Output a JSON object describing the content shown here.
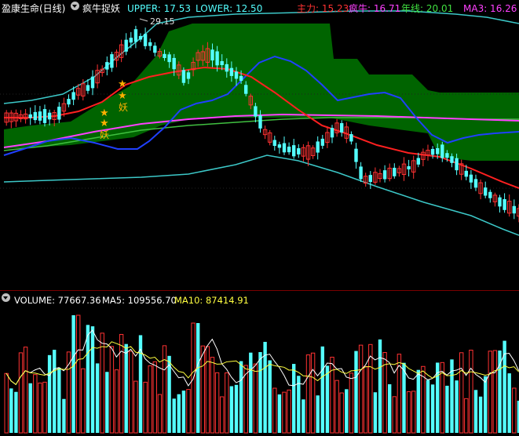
{
  "header": {
    "stock_name": "盈康生命(日线)",
    "indicator_name": "疯牛捉妖",
    "upper": "UPPER: 17.53",
    "lower": "LOWER: 12.50",
    "zhuli": "主力: 15.23",
    "fengniu": "疯牛: 16.71",
    "nianxian": "年线: 20.01",
    "ma3": "MA3: 16.26"
  },
  "price_chart": {
    "high_label": "29.15",
    "signal_glyph": "★",
    "signal_text": "妖"
  },
  "volume_header": {
    "volume": "VOLUME: 77667.36",
    "ma5": "MA5: 109556.70",
    "ma10": "MA10: 87414.91"
  },
  "colors": {
    "background": "#000000",
    "up_candle": "#ff3232",
    "down_candle": "#54ffff",
    "band_fill": "#006400",
    "upper_lower_band": "#3cc8c8",
    "main_line": "#ff2020",
    "blue_line": "#2040ff",
    "magenta_line": "#ff40ff",
    "green_line": "#40c040",
    "star": "#ffb000",
    "ma5_line": "#ffffff",
    "ma10_line": "#ffff40"
  },
  "icons": {
    "menu": "dropdown-icon"
  }
}
